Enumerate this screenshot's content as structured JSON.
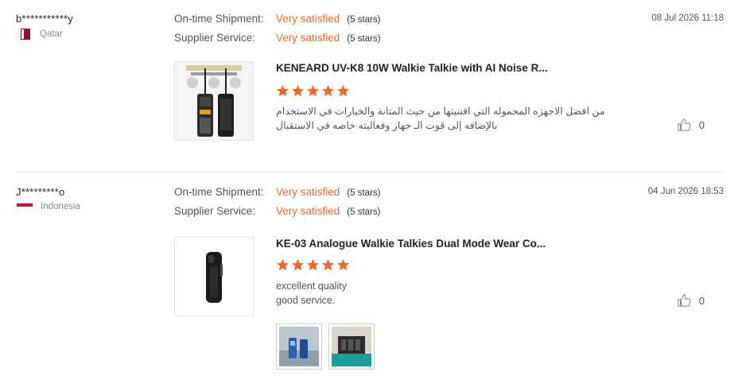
{
  "reviews": [
    {
      "username": "b***********y",
      "country": "Qatar",
      "ratings": [
        {
          "label": "On-time Shipment:",
          "value": "Very satisfied",
          "stars": "(5 stars)"
        },
        {
          "label": "Supplier Service:",
          "value": "Very satisfied",
          "stars": "(5 stars)"
        }
      ],
      "date": "08 Jul 2026 11:18",
      "product_title": "KENEARD UV-K8 10W Walkie Talkie with AI Noise R...",
      "star_rating": 5,
      "comment": "من افضل الاجهزه المحموله التي اقتنيتها من حيث المتانة والخيارات في الاستخدام بالإضافه إلى قوت الـ جهاز وفعاليته خاصه في الاستقبال",
      "likes": "0"
    },
    {
      "username": "J*********o",
      "country": "Indonesia",
      "ratings": [
        {
          "label": "On-time Shipment:",
          "value": "Very satisfied",
          "stars": "(5 stars)"
        },
        {
          "label": "Supplier Service:",
          "value": "Very satisfied",
          "stars": "(5 stars)"
        }
      ],
      "date": "04 Jun 2026 18:53",
      "product_title": "KE-03 Analogue Walkie Talkies Dual Mode Wear Co...",
      "star_rating": 5,
      "comment_line1": "excellent quality",
      "comment_line2": "good service.",
      "likes": "0"
    }
  ],
  "colors": {
    "accent": "#f26522",
    "star": "#f26522"
  }
}
